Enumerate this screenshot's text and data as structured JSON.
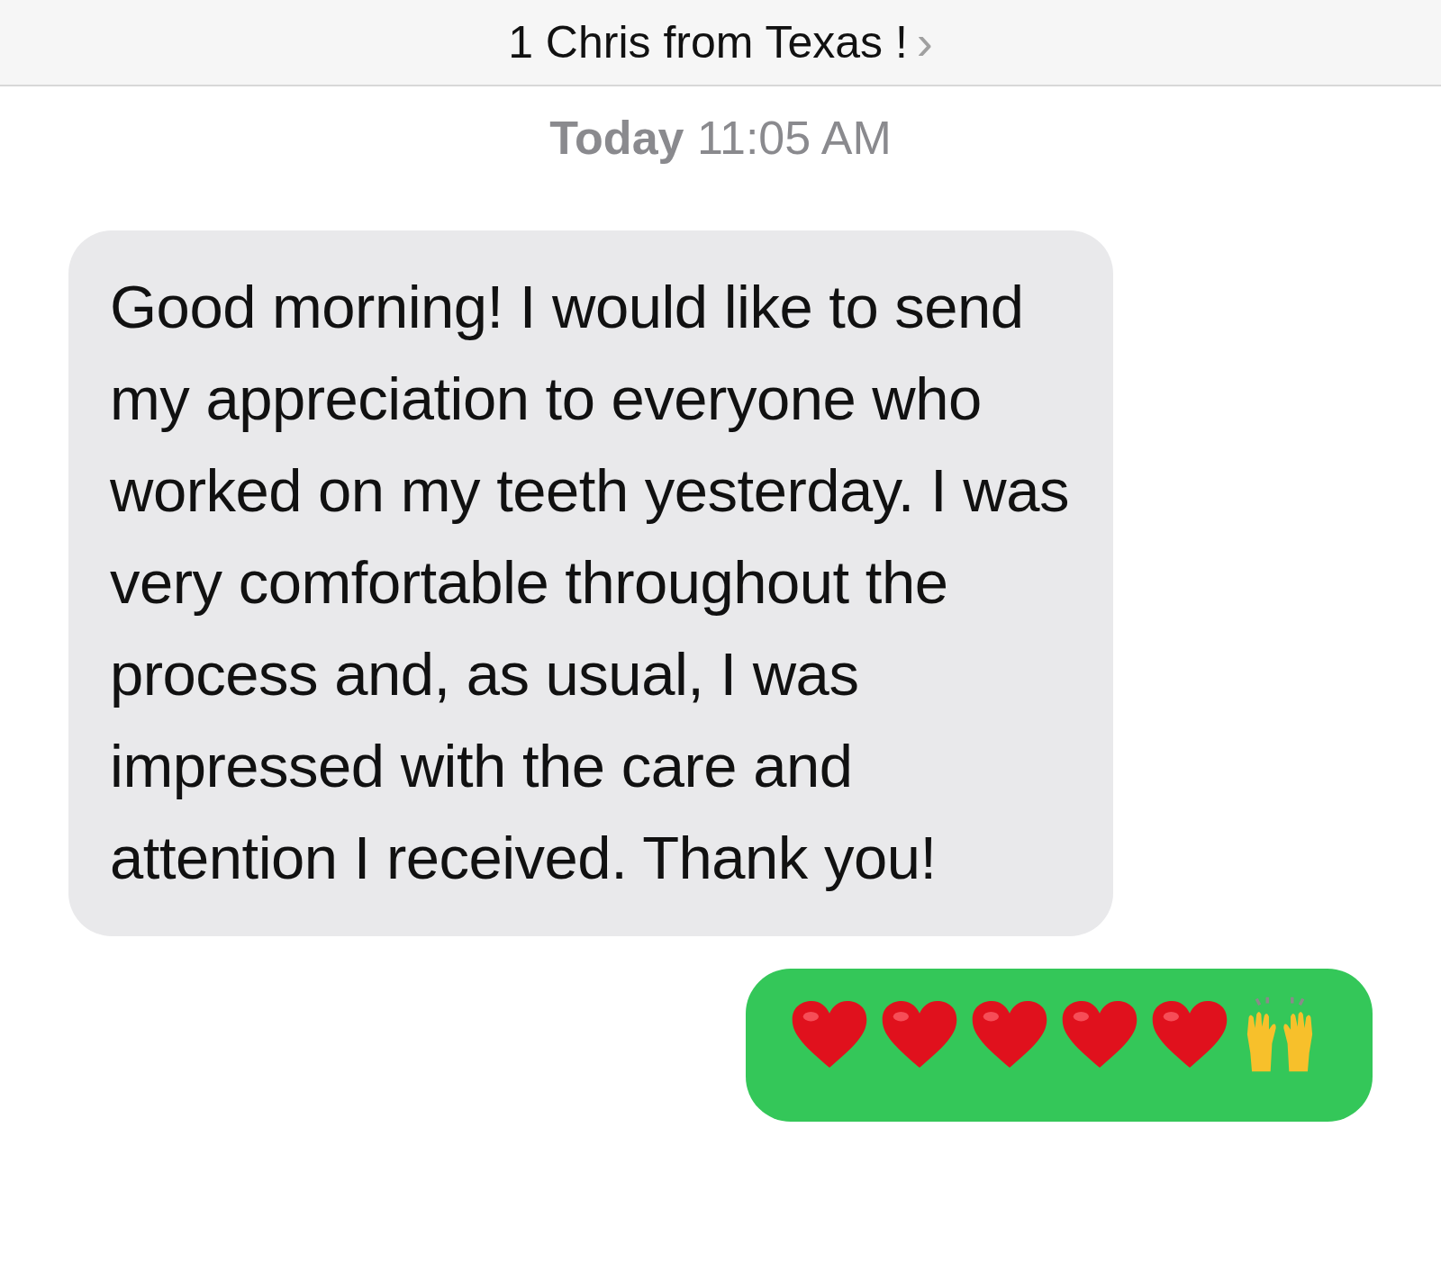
{
  "header": {
    "title": "1 Chris from Texas !",
    "chevron": "›"
  },
  "timestamp": "**Today** 11:05 AM",
  "messages": [
    {
      "kind": "received",
      "text": "Good morning! I would like to send my appreciation to everyone who worked on my teeth yesterday. I was very comfortable throughout the process and, as usual, I was impressed with the care and attention I received. Thank you!"
    },
    {
      "kind": "sent",
      "emoji": [
        {
          "kind": "heart"
        },
        {
          "kind": "heart"
        },
        {
          "kind": "heart"
        },
        {
          "kind": "heart"
        },
        {
          "kind": "heart"
        },
        {
          "kind": "raised-hands"
        }
      ]
    }
  ]
}
